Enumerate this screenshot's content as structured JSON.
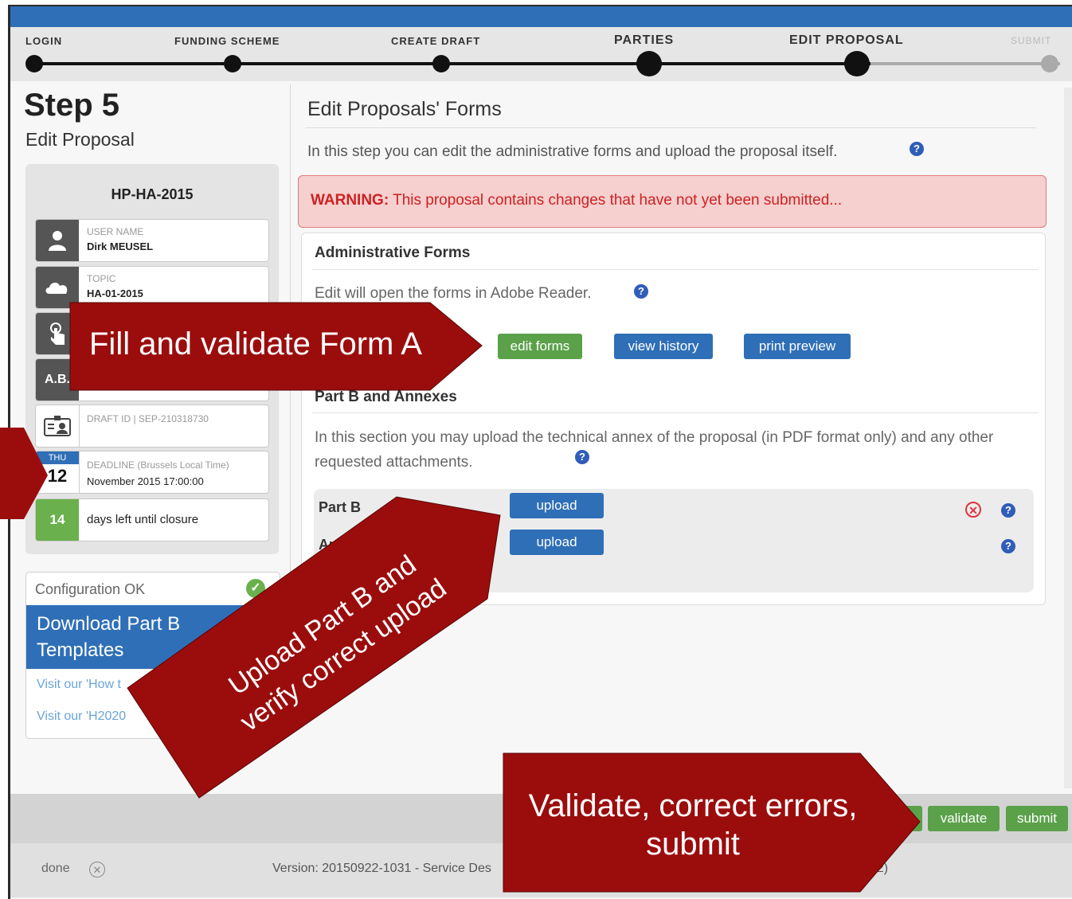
{
  "stepper": {
    "steps": [
      "LOGIN",
      "FUNDING SCHEME",
      "CREATE DRAFT",
      "PARTIES",
      "EDIT PROPOSAL",
      "SUBMIT"
    ]
  },
  "step": {
    "title": "Step 5",
    "subtitle": "Edit Proposal"
  },
  "proposal": {
    "acronym": "HP-HA-2015",
    "user_label": "USER NAME",
    "user_value": "Dirk MEUSEL",
    "topic_label": "TOPIC",
    "topic_value": "HA-01-2015",
    "abbr": "A.B.",
    "draft_label": "DRAFT ID | SEP-210318730",
    "deadline_day": "THU",
    "deadline_date": "12",
    "deadline_label": "DEADLINE (Brussels Local Time)",
    "deadline_value": "November 2015 17:00:00",
    "days_left": "14",
    "days_left_label": "days left until closure"
  },
  "sidebar": {
    "config_status": "Configuration OK",
    "download_label": "Download Part B Templates",
    "visit_how": "Visit our 'How t",
    "visit_h2020": "Visit our 'H2020"
  },
  "content": {
    "title": "Edit Proposals' Forms",
    "intro": "In this step you can edit the administrative forms and upload the proposal itself.",
    "warning_label": "WARNING:",
    "warning_text": "This proposal contains changes that have not yet been submitted..."
  },
  "admin_forms": {
    "title": "Administrative Forms",
    "description": "Edit will open the forms in Adobe Reader.",
    "edit_label": "edit forms",
    "history_label": "view history",
    "print_label": "print preview"
  },
  "part_b": {
    "title": "Part B and Annexes",
    "description": "In this section you may upload the technical annex of the proposal (in PDF format only) and any other requested attachments.",
    "row1_label": "Part B",
    "row2_label": "Au",
    "upload_label": "upload"
  },
  "actions": {
    "validate_label": "validate",
    "submit_label": "submit"
  },
  "status_bar": {
    "done_label": "done",
    "version_text": "Version: 20150922-1031 - Service Des",
    "version_tail": "22)"
  },
  "callouts": {
    "form_a": "Fill and validate Form A",
    "upload": "Upload Part B and verify correct upload",
    "upload_line1": "Upload Part B and",
    "upload_line2": "verify correct upload",
    "validate_line1": "Validate, correct errors,",
    "validate_line2": "submit"
  },
  "colors": {
    "accent_blue": "#2f6fb7",
    "button_green": "#5aa14a",
    "warning_red": "#cc2222",
    "callout_red": "#9b0d0d"
  },
  "icons": {
    "user": "person-icon",
    "topic": "cloud-icon",
    "touch": "touch-icon",
    "draft": "id-card-icon",
    "help": "help-icon",
    "ok": "check-icon",
    "delete": "delete-icon"
  }
}
